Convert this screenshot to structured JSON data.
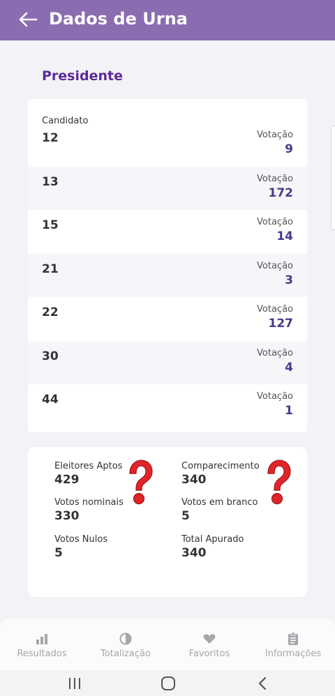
{
  "header": {
    "title": "Dados de Urna"
  },
  "section": {
    "title": "Presidente"
  },
  "candidates": {
    "column_header": "Candidato",
    "vote_label": "Votação",
    "rows": [
      {
        "number": "12",
        "votes": "9"
      },
      {
        "number": "13",
        "votes": "172"
      },
      {
        "number": "15",
        "votes": "14"
      },
      {
        "number": "21",
        "votes": "3"
      },
      {
        "number": "22",
        "votes": "127"
      },
      {
        "number": "30",
        "votes": "4"
      },
      {
        "number": "44",
        "votes": "1"
      }
    ]
  },
  "stats": {
    "eleitores_aptos": {
      "label": "Eleitores Aptos",
      "value": "429"
    },
    "comparecimento": {
      "label": "Comparecimento",
      "value": "340"
    },
    "votos_nominais": {
      "label": "Votos nominais",
      "value": "330"
    },
    "votos_branco": {
      "label": "Votos em branco",
      "value": "5"
    },
    "votos_nulos": {
      "label": "Votos Nulos",
      "value": "5"
    },
    "total_apurado": {
      "label": "Total Apurado",
      "value": "340"
    }
  },
  "bottom_nav": {
    "items": [
      {
        "label": "Resultados",
        "icon": "bar-chart-icon"
      },
      {
        "label": "Totalização",
        "icon": "pie-chart-icon"
      },
      {
        "label": "Favoritos",
        "icon": "heart-icon"
      },
      {
        "label": "Informações",
        "icon": "clipboard-icon"
      }
    ]
  },
  "colors": {
    "appbar": "#8a6db1",
    "section_title": "#5b2a98",
    "vote_value": "#4a3a8c",
    "question_mark": "#e0252b"
  }
}
